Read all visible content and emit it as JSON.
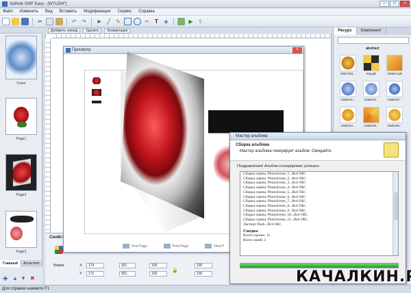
{
  "window": {
    "title": "Sothink SWF Easy - [WYLEM*]",
    "min": "–",
    "max": "□",
    "close": "×"
  },
  "menu": [
    "Файл",
    "Изменить",
    "Вид",
    "Вставить",
    "Модификация",
    "Сервис",
    "Справка"
  ],
  "toolbar_icons": [
    "new-icon",
    "open-icon",
    "save-icon",
    "cut-icon",
    "copy-icon",
    "paste-icon",
    "undo-icon",
    "redo-icon",
    "arrow-icon",
    "line-icon",
    "pen-icon",
    "rect-icon",
    "oval-icon",
    "pencil-icon",
    "text-icon",
    "fill-icon",
    "image-icon",
    "play-icon",
    "export-icon"
  ],
  "work_tabs": [
    "Добавить эпизод",
    "Удалить",
    "Конвертация"
  ],
  "pages": [
    {
      "label": "Cover"
    },
    {
      "label": "Page1"
    },
    {
      "label": "Page2"
    },
    {
      "label": "Page3"
    }
  ],
  "left_tabs": {
    "main": "Главный",
    "assistant": "Ассистент"
  },
  "props": {
    "title": "Свойство",
    "form_label": "Форма",
    "x_label": "X:",
    "x_value": "174",
    "y_label": "Y:",
    "y_value": "171",
    "w_value": "351.",
    "h_value": "901.",
    "sx_value": "100",
    "sy_value": "100",
    "sw_value": "100",
    "sh_value": "100"
  },
  "preview": {
    "title": "Просмотр",
    "close": "×",
    "buttons": [
      "First Page",
      "Print Page",
      "Next P"
    ]
  },
  "resources": {
    "tabs": [
      "Ресурс",
      "Компонент"
    ],
    "category": "abstract",
    "items": [
      "relief-sha...",
      "img.gls",
      "rotation.gls",
      "rotation1...",
      "rotation2...",
      "rotation3...",
      "rotation4...",
      "rotation5...",
      "rotation6...",
      "",
      "",
      ""
    ]
  },
  "wizard": {
    "title": "Мастер альбома",
    "heading": "Сборка альбома",
    "subheading": "Мастер альбома генерирует альбом. Ожидайте.",
    "status": "Поздравления! Альбом сгенерирован успешно.",
    "log": [
      "Сборка сцены: PhotoScene_1...Всё ОК!.",
      "Сборка сцены: PhotoScene_2...Всё ОК!.",
      "Сборка сцены: PhotoScene_3...Всё ОК!.",
      "Сборка сцены: PhotoScene_4...Всё ОК!.",
      "Сборка сцены: PhotoScene_5...Всё ОК!.",
      "Сборка сцены: PhotoScene_6...Всё ОК!.",
      "Сборка сцены: PhotoScene_7...Всё ОК!.",
      "Сборка сцены: PhotoScene_8...Всё ОК!.",
      "Сборка сцены: PhotoScene_9...Всё ОК!.",
      "Сборка сцены: PhotoScene_10...Всё ОК!.",
      "Сборка сцены: PhotoScene_11...Всё ОК!.",
      "Экспорт flash...Всё ОК!."
    ],
    "summary_title": "Сводка",
    "summary_scenes": "Всего сценок: 11",
    "summary_errors": "Всего ошиб: 2",
    "progress": 1.0
  },
  "watermark": "КАЧАЛКИН.РУ",
  "status": "Для справки нажмите F1",
  "colors": {
    "rose": "#c8161d",
    "progress": "#2eaa2e",
    "accent": "#3c6fb0"
  }
}
